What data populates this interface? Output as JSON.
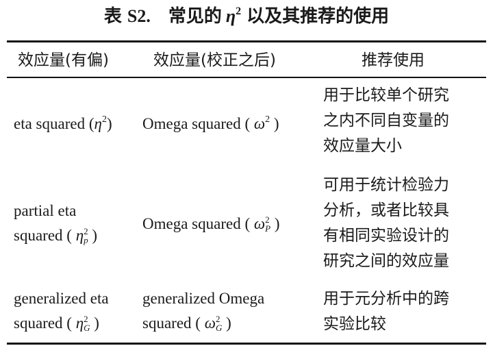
{
  "caption": {
    "prefix": "表",
    "number": "S2.",
    "text_before": "常见的",
    "symbol": "η",
    "superscript": "2",
    "text_after": "以及其推荐的使用"
  },
  "table": {
    "headers": [
      "效应量(有偏)",
      "效应量(校正之后)",
      "推荐使用"
    ],
    "rows": [
      {
        "biased": {
          "name": "eta squared",
          "symbol": "η",
          "sup": "2",
          "sub": ""
        },
        "corrected": {
          "name": "Omega squared",
          "symbol": "ω",
          "sup": "2",
          "sub": ""
        },
        "usage_lines": [
          "用于比较单个研究",
          "之内不同自变量的",
          "效应量大小"
        ]
      },
      {
        "biased": {
          "line1": "partial eta",
          "line2": "squared",
          "symbol": "η",
          "sup": "2",
          "sub": "p"
        },
        "corrected": {
          "name": "Omega squared",
          "symbol": "ω",
          "sup": "2",
          "sub": "P"
        },
        "usage_lines": [
          "可用于统计检验力",
          "分析，或者比较具",
          "有相同实验设计的",
          "研究之间的效应量"
        ]
      },
      {
        "biased": {
          "line1": "generalized eta",
          "line2": "squared",
          "symbol": "η",
          "sup": "2",
          "sub": "G"
        },
        "corrected": {
          "line1": "generalized Omega",
          "line2": "squared",
          "symbol": "ω",
          "sup": "2",
          "sub": "G"
        },
        "usage_lines": [
          "用于元分析中的跨",
          "实验比较"
        ]
      }
    ]
  }
}
